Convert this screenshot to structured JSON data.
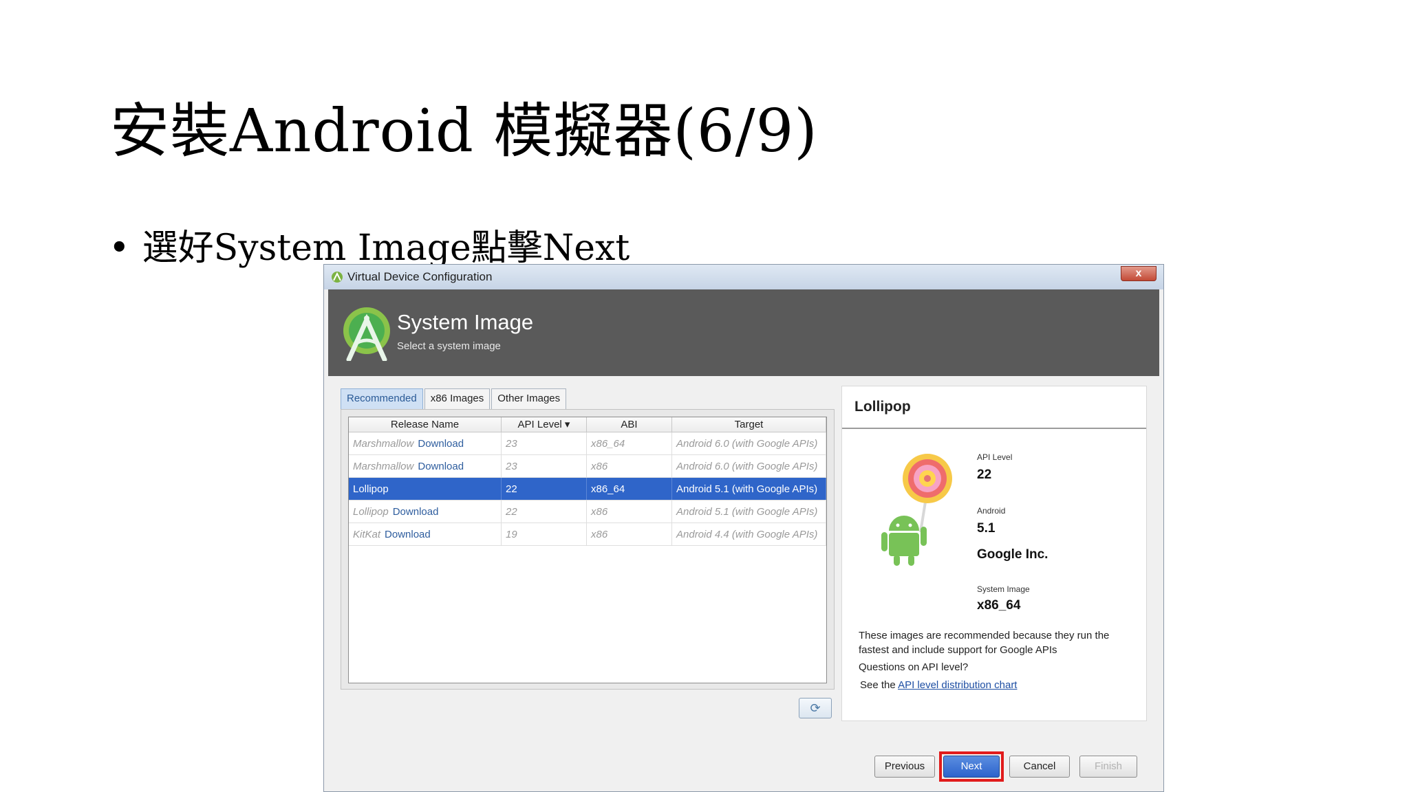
{
  "slide": {
    "title": "安裝Android 模擬器(6/9)",
    "bullet": "選好System Image點擊Next",
    "bullet_marker": "•"
  },
  "window": {
    "title": "Virtual Device Configuration",
    "close_label": "x",
    "header": {
      "title": "System Image",
      "subtitle": "Select a system image"
    },
    "tabs": [
      "Recommended",
      "x86 Images",
      "Other Images"
    ],
    "active_tab": "Recommended",
    "table": {
      "columns": [
        "Release Name",
        "API Level ▾",
        "ABI",
        "Target"
      ],
      "rows": [
        {
          "release": "Marshmallow",
          "download": "Download",
          "api": "23",
          "abi": "x86_64",
          "target": "Android 6.0 (with Google APIs)",
          "selected": false
        },
        {
          "release": "Marshmallow",
          "download": "Download",
          "api": "23",
          "abi": "x86",
          "target": "Android 6.0 (with Google APIs)",
          "selected": false
        },
        {
          "release": "Lollipop",
          "download": "",
          "api": "22",
          "abi": "x86_64",
          "target": "Android 5.1 (with Google APIs)",
          "selected": true
        },
        {
          "release": "Lollipop",
          "download": "Download",
          "api": "22",
          "abi": "x86",
          "target": "Android 5.1 (with Google APIs)",
          "selected": false
        },
        {
          "release": "KitKat",
          "download": "Download",
          "api": "19",
          "abi": "x86",
          "target": "Android 4.4 (with Google APIs)",
          "selected": false
        }
      ]
    },
    "refresh_glyph": "⟳",
    "details": {
      "title": "Lollipop",
      "api_level_label": "API Level",
      "api_level_value": "22",
      "android_label": "Android",
      "android_value": "5.1",
      "vendor": "Google Inc.",
      "system_image_label": "System Image",
      "system_image_value": "x86_64",
      "description": "These images are recommended because they run the fastest and include support for Google APIs",
      "question": "Questions on API level?",
      "see_prefix": "See the ",
      "link_text": "API level distribution chart"
    },
    "buttons": {
      "previous": "Previous",
      "next": "Next",
      "cancel": "Cancel",
      "finish": "Finish"
    },
    "colors": {
      "selection": "#2f65c9",
      "highlight_outline": "#e11b1b",
      "header_band": "#5a5a5a"
    }
  }
}
